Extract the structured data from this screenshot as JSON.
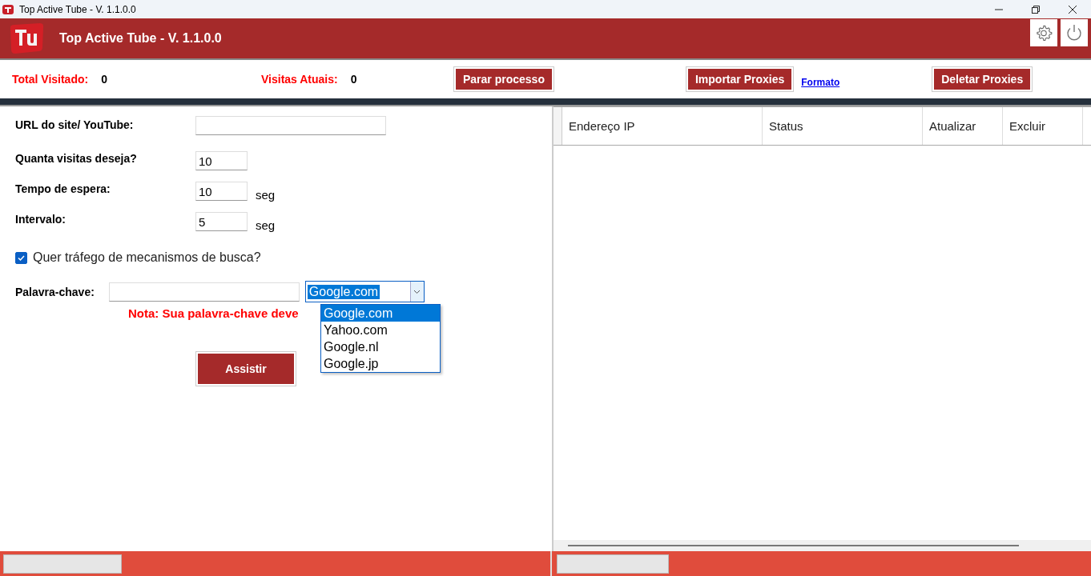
{
  "window": {
    "title": "Top Active Tube - V. 1.1.0.0"
  },
  "header": {
    "title": "Top Active Tube - V. 1.1.0.0"
  },
  "stats": [
    {
      "label": "Total Visitado:",
      "value": "0"
    },
    {
      "label": "Visitas Atuais:",
      "value": "0"
    }
  ],
  "toolbar": {
    "stop_button": "Parar processo",
    "import_button": "Importar Proxies",
    "format_link": "Formato",
    "delete_button": "Deletar Proxies"
  },
  "form": {
    "fields": [
      {
        "label": "URL do site/ YouTube:",
        "kind": "wide"
      },
      {
        "label": "Quanta visitas deseja?",
        "value": "10",
        "kind": "short"
      },
      {
        "label": "Tempo de espera:",
        "value": "10",
        "kind": "short",
        "unit": "seg"
      },
      {
        "label": "Intervalo:",
        "value": "5",
        "kind": "short",
        "unit": "seg"
      }
    ],
    "search_traffic": {
      "label": "Quer tráfego de mecanismos de busca?",
      "checked": true
    },
    "keyword": {
      "label": "Palavra-chave:",
      "engine": "Google.com",
      "options": [
        {
          "label": "Google.com",
          "selected": true
        },
        {
          "label": "Yahoo.com",
          "selected": false
        },
        {
          "label": "Google.nl",
          "selected": false
        },
        {
          "label": "Google.jp",
          "selected": false
        }
      ]
    },
    "note": "Nota: Sua palavra-chave deve",
    "submit_button": "Assistir"
  },
  "proxy_table": {
    "columns": [
      "Endereço IP",
      "Status",
      "Atualizar",
      "Excluir"
    ]
  }
}
